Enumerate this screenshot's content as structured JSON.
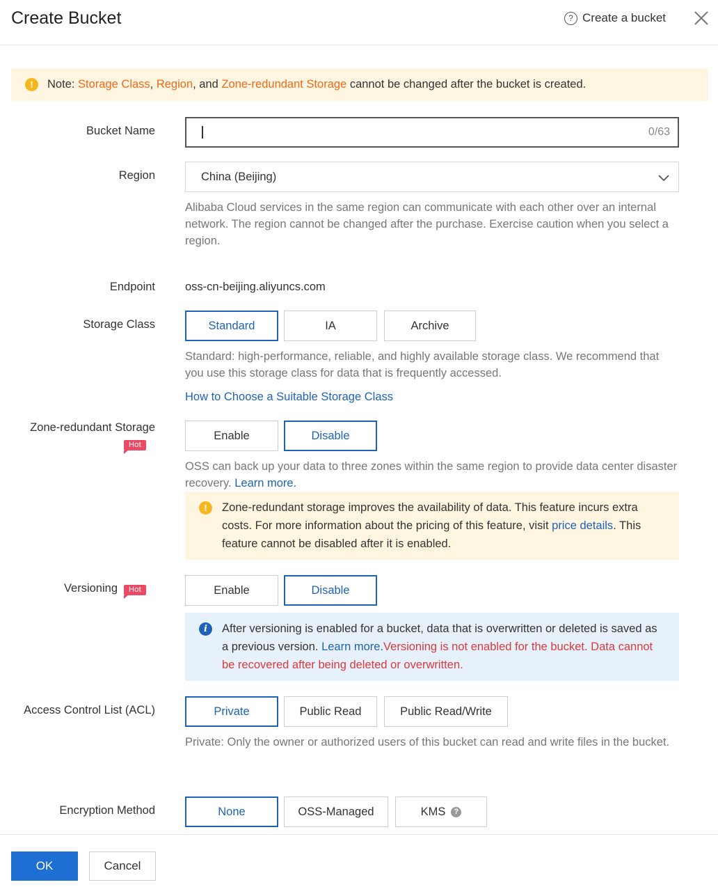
{
  "header": {
    "title": "Create Bucket",
    "help_link": "Create a bucket",
    "help_icon": "question-circle-icon",
    "close_icon": "close-icon"
  },
  "note": {
    "prefix": "Note: ",
    "term1": "Storage Class",
    "sep1": ", ",
    "term2": "Region",
    "sep2": ", and ",
    "term3": "Zone-redundant Storage",
    "suffix": " cannot be changed after the bucket is created."
  },
  "bucket_name": {
    "label": "Bucket Name",
    "value": "",
    "counter": "0/63"
  },
  "region": {
    "label": "Region",
    "selected": "China (Beijing)",
    "help": "Alibaba Cloud services in the same region can communicate with each other over an internal network. The region cannot be changed after the purchase. Exercise caution when you select a region."
  },
  "endpoint": {
    "label": "Endpoint",
    "value": "oss-cn-beijing.aliyuncs.com"
  },
  "storage_class": {
    "label": "Storage Class",
    "options": [
      "Standard",
      "IA",
      "Archive"
    ],
    "selected": "Standard",
    "help": "Standard: high-performance, reliable, and highly available storage class. We recommend that you use this storage class for data that is frequently accessed.",
    "link": "How to Choose a Suitable Storage Class"
  },
  "zone_redundant": {
    "label": "Zone-redundant Storage",
    "badge": "Hot",
    "options": [
      "Enable",
      "Disable"
    ],
    "selected": "Disable",
    "help": "OSS can back up your data to three zones within the same region to provide data center disaster recovery. ",
    "help_link": "Learn more.",
    "alert_text": "Zone-redundant storage improves the availability of data. This feature incurs extra costs. For more information about the pricing of this feature, visit ",
    "alert_link": "price details",
    "alert_suffix": ". This feature cannot be disabled after it is enabled."
  },
  "versioning": {
    "label": "Versioning",
    "badge": "Hot",
    "options": [
      "Enable",
      "Disable"
    ],
    "selected": "Disable",
    "info_text": "After versioning is enabled for a bucket, data that is overwritten or deleted is saved as a previous version. ",
    "info_link": "Learn more.",
    "info_warning": "Versioning is not enabled for the bucket. Data cannot be recovered after being deleted or overwritten."
  },
  "acl": {
    "label": "Access Control List (ACL)",
    "options": [
      "Private",
      "Public Read",
      "Public Read/Write"
    ],
    "selected": "Private",
    "help": "Private: Only the owner or authorized users of this bucket can read and write files in the bucket."
  },
  "encryption": {
    "label": "Encryption Method",
    "options": [
      "None",
      "OSS-Managed",
      "KMS"
    ],
    "selected": "None"
  },
  "footer": {
    "ok": "OK",
    "cancel": "Cancel"
  },
  "colors": {
    "primary": "#1e6fd4",
    "accent_orange": "#ed6a1a",
    "warning_red": "#d93a3a",
    "hot_badge": "#e94b64"
  }
}
